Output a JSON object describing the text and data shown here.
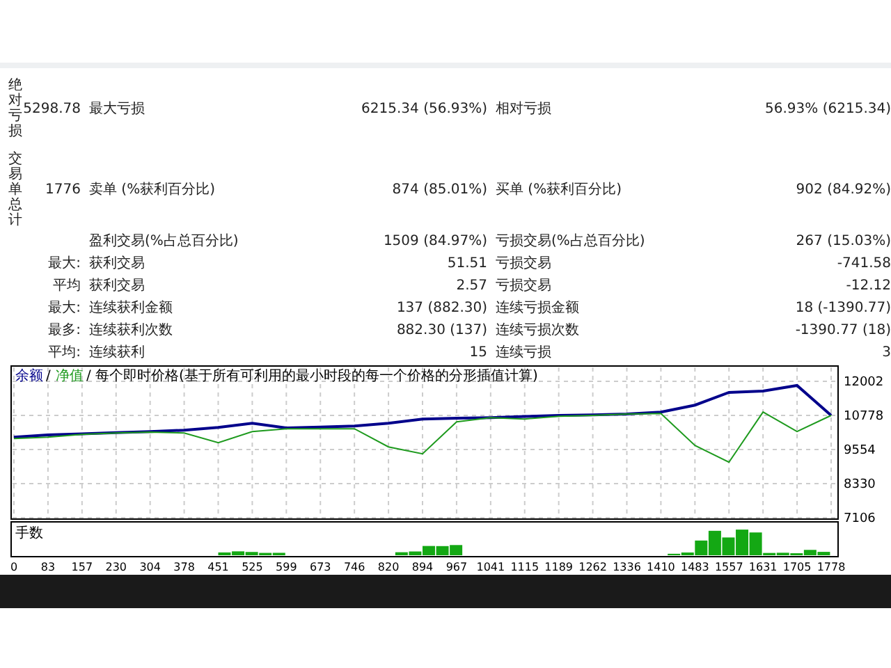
{
  "summary": [
    {
      "side_label": "绝对亏损",
      "value": "5298.78",
      "label": "最大亏损",
      "value2": "6215.34 (56.93%)",
      "label2": "相对亏损",
      "value3": "56.93% (6215.34)"
    },
    {
      "side_label": "交易单总计",
      "value": "1776",
      "label": "卖单 (%获利百分比)",
      "value2": "874 (85.01%)",
      "label2": "买单 (%获利百分比)",
      "value3": "902 (84.92%)"
    }
  ],
  "stats": [
    {
      "label": "盈利交易(%占总百分比)",
      "value2": "1509 (84.97%)",
      "label2": "亏损交易(%占总百分比)",
      "value3": "267 (15.03%)"
    },
    {
      "prefix": "最大:",
      "label": "获利交易",
      "value2": "51.51",
      "label2": "亏损交易",
      "value3": "-741.58"
    },
    {
      "prefix": "平均",
      "label": "获利交易",
      "value2": "2.57",
      "label2": "亏损交易",
      "value3": "-12.12"
    },
    {
      "prefix": "最大:",
      "label": "连续获利金额",
      "value2": "137 (882.30)",
      "label2": "连续亏损金额",
      "value3": "18 (-1390.77)"
    },
    {
      "prefix": "最多:",
      "label": "连续获利次数",
      "value2": "882.30 (137)",
      "label2": "连续亏损次数",
      "value3": "-1390.77 (18)"
    },
    {
      "prefix": "平均:",
      "label": "连续获利",
      "value2": "15",
      "label2": "连续亏损",
      "value3": "3"
    }
  ],
  "chart": {
    "legend_rest": "/ 每个即时价格(基于所有可利用的最小时段的每一个价格的分形插值计算)",
    "separator": "/",
    "volume_label": "手数",
    "chart_data": {
      "type": "line",
      "categories": [
        "0",
        "83",
        "157",
        "230",
        "304",
        "378",
        "451",
        "525",
        "599",
        "673",
        "746",
        "820",
        "894",
        "967",
        "1041",
        "1115",
        "1189",
        "1262",
        "1336",
        "1410",
        "1483",
        "1557",
        "1631",
        "1705",
        "1778"
      ],
      "grid": true,
      "ylim": [
        7106,
        12002
      ],
      "yticks": [
        7106,
        8330,
        9554,
        10778,
        12002
      ],
      "series": [
        {
          "name": "余额",
          "color": "#00008b",
          "values": [
            10000,
            10080,
            10120,
            10160,
            10200,
            10250,
            10350,
            10500,
            10330,
            10360,
            10400,
            10500,
            10650,
            10680,
            10700,
            10740,
            10780,
            10800,
            10830,
            10900,
            11150,
            11600,
            11650,
            11850,
            10780
          ]
        },
        {
          "name": "净值",
          "color": "#1e9a1e",
          "values": [
            9950,
            10000,
            10100,
            10150,
            10180,
            10150,
            9800,
            10200,
            10300,
            10300,
            10300,
            9650,
            9400,
            10550,
            10700,
            10650,
            10750,
            10780,
            10830,
            10850,
            9700,
            9100,
            10900,
            10200,
            10780
          ]
        }
      ]
    }
  }
}
